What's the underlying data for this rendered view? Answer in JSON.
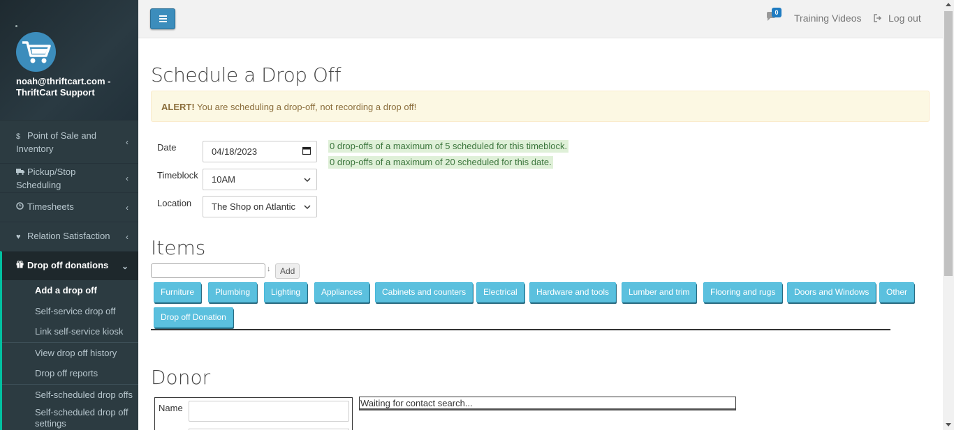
{
  "sidebar": {
    "user": "noah@thriftcart.com - ThriftCart Support",
    "items": [
      {
        "label": "Point of Sale and Inventory",
        "icon": "dollar-icon"
      },
      {
        "label": "Pickup/Stop Scheduling",
        "icon": "truck-icon"
      },
      {
        "label": "Timesheets",
        "icon": "clock-icon"
      },
      {
        "label": "Relation Satisfaction",
        "icon": "heart-icon"
      },
      {
        "label": "Drop off donations",
        "icon": "gift-icon"
      }
    ],
    "subitems": [
      "Add a drop off",
      "Self-service drop off",
      "Link self-service kiosk",
      "View drop off history",
      "Drop off reports",
      "Self-scheduled drop offs",
      "Self-scheduled drop off settings"
    ]
  },
  "topbar": {
    "chat_count": "0",
    "training": "Training Videos",
    "logout": "Log out"
  },
  "page": {
    "title": "Schedule a Drop Off",
    "alert_strong": "ALERT!",
    "alert_text": " You are scheduling a drop-off, not recording a drop off!"
  },
  "form": {
    "date_label": "Date",
    "date_value": "04/18/2023",
    "timeblock_label": "Timeblock",
    "timeblock_value": "10AM",
    "location_label": "Location",
    "location_value": "The Shop on Atlantic",
    "note_timeblock": "0 drop-offs of a maximum of 5 scheduled for this timeblock.",
    "note_date": "0 drop-offs of a maximum of 20 scheduled for this date."
  },
  "items": {
    "title": "Items",
    "sort_symbol": "↓",
    "add_label": "Add",
    "categories": [
      "Furniture",
      "Plumbing",
      "Lighting",
      "Appliances",
      "Cabinets and counters",
      "Electrical",
      "Hardware and tools",
      "Lumber and trim",
      "Flooring and rugs",
      "Doors and Windows",
      "Other",
      "Drop off Donation"
    ]
  },
  "donor": {
    "title": "Donor",
    "name_label": "Name",
    "contact_status": "Waiting for contact search..."
  },
  "colors": {
    "sidebar_bg": "#2c3b41",
    "accent": "#00c0a0",
    "primary": "#3c8dbc",
    "info_button": "#5bc0de"
  }
}
